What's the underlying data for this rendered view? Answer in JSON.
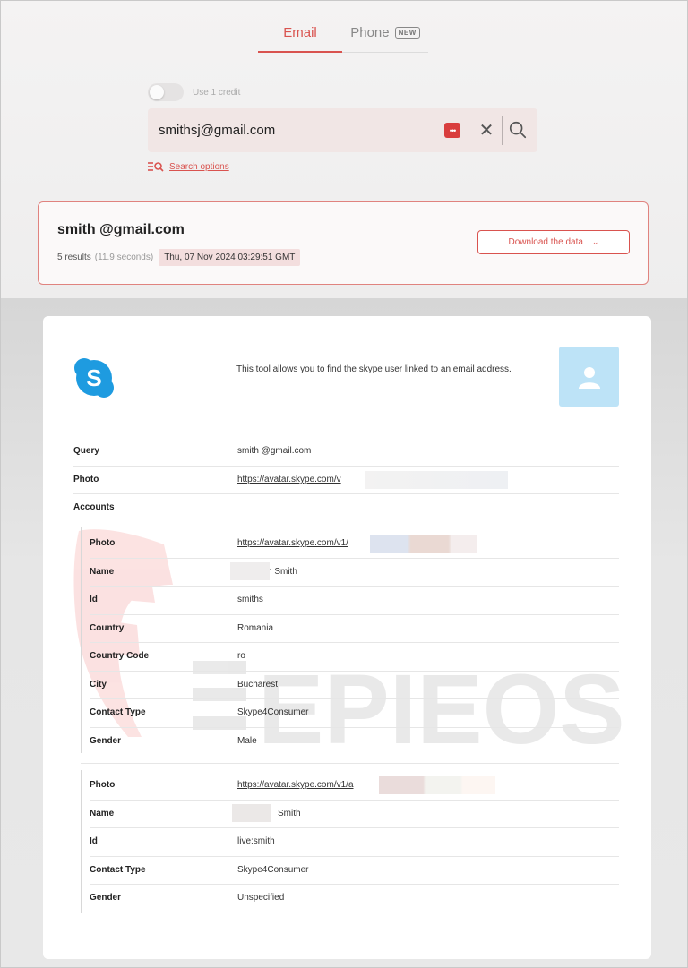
{
  "tabs": {
    "email_label": "Email",
    "phone_label": "Phone",
    "phone_badge": "NEW"
  },
  "toggle": {
    "label": "Use 1 credit",
    "on": false
  },
  "search": {
    "value": "smithsj@gmail.com",
    "search_options_label": "Search options"
  },
  "result": {
    "email": "smith   @gmail.com",
    "count_text": "5 results",
    "duration_text": "(11.9 seconds)",
    "date_text": "Thu, 07 Nov 2024 03:29:51 GMT",
    "download_label": "Download the data"
  },
  "module": {
    "icon": "skype-icon",
    "description": "This tool allows you to find the skype user linked to an email address.",
    "query_label": "Query",
    "query_value": "smith   @gmail.com",
    "photo_label": "Photo",
    "photo_value": "https://avatar.skype.com/v",
    "accounts_label": "Accounts",
    "accounts": [
      {
        "fields": [
          {
            "label": "Photo",
            "value": "https://avatar.skype.com/v1/",
            "link": true
          },
          {
            "label": "Name",
            "value": "h Smith",
            "link": false
          },
          {
            "label": "Id",
            "value": "smiths",
            "link": false
          },
          {
            "label": "Country",
            "value": "Romania",
            "link": false
          },
          {
            "label": "Country Code",
            "value": "ro",
            "link": false
          },
          {
            "label": "City",
            "value": "Bucharest",
            "link": false
          },
          {
            "label": "Contact Type",
            "value": "Skype4Consumer",
            "link": false
          },
          {
            "label": "Gender",
            "value": "Male",
            "link": false
          }
        ]
      },
      {
        "fields": [
          {
            "label": "Photo",
            "value": "https://avatar.skype.com/v1/a",
            "link": true
          },
          {
            "label": "Name",
            "value": "Smith",
            "link": false
          },
          {
            "label": "Id",
            "value": "live:smith",
            "link": false
          },
          {
            "label": "Contact Type",
            "value": "Skype4Consumer",
            "link": false
          },
          {
            "label": "Gender",
            "value": "Unspecified",
            "link": false
          }
        ]
      }
    ]
  },
  "watermark": {
    "text": "EPIEOS"
  },
  "colors": {
    "accent": "#d9534f",
    "skype": "#1e9be0",
    "avatar_bg": "#bde3f7"
  }
}
